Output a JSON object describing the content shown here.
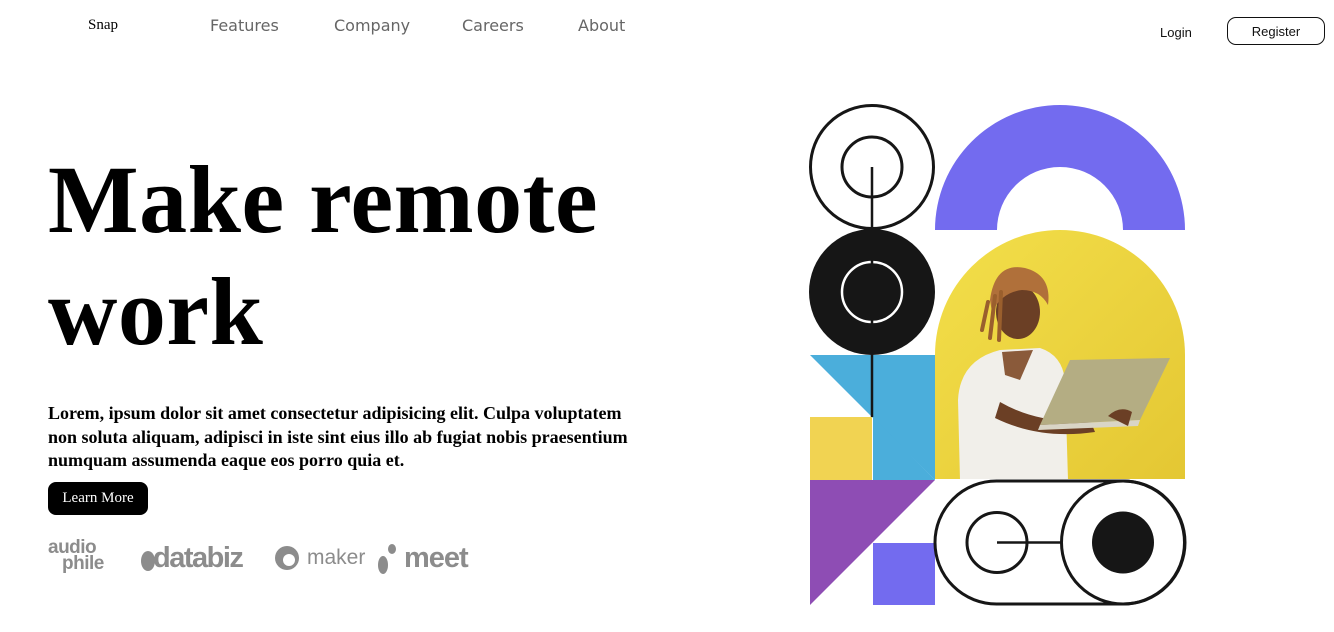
{
  "nav": {
    "logo": "Snap",
    "links": [
      "Features",
      "Company",
      "Careers",
      "About"
    ],
    "login": "Login",
    "register": "Register"
  },
  "hero": {
    "title": "Make remote work",
    "description": "Lorem, ipsum dolor sit amet consectetur adipisicing elit. Culpa voluptatem non soluta aliquam, adipisci in iste sint eius illo ab fugiat nobis praesentium numquam assumenda eaque eos porro quia et.",
    "cta": "Learn More"
  },
  "clients": {
    "audiophile_top": "audio",
    "audiophile_bottom": "phile",
    "databiz": "databiz",
    "maker": "maker",
    "meet": "meet"
  },
  "colors": {
    "purple_accent": "#736BEF",
    "yellow": "#F1D352",
    "cyan": "#4BAEDB",
    "violet": "#8E4DB4",
    "dark": "#161616",
    "logo_gray": "#8C8C8C"
  }
}
